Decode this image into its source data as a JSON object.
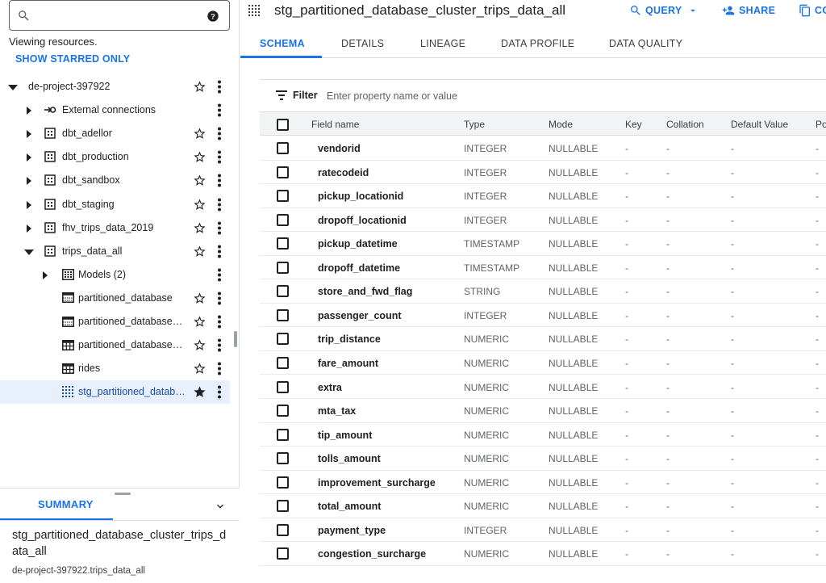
{
  "search": {
    "value": "",
    "placeholder": ""
  },
  "viewing_text": "Viewing resources.",
  "show_starred": "SHOW STARRED ONLY",
  "tree": [
    {
      "label": "de-project-397922",
      "level": 0,
      "expanded": true,
      "icon": "none",
      "star": true,
      "starred": false,
      "top": 0
    },
    {
      "label": "External connections",
      "level": 1,
      "expanded": false,
      "icon": "connection-icon",
      "star": false,
      "starred": false
    },
    {
      "label": "dbt_adellor",
      "level": 1,
      "expanded": false,
      "icon": "dataset-icon",
      "star": true,
      "starred": false
    },
    {
      "label": "dbt_production",
      "level": 1,
      "expanded": false,
      "icon": "dataset-icon",
      "star": true,
      "starred": false
    },
    {
      "label": "dbt_sandbox",
      "level": 1,
      "expanded": false,
      "icon": "dataset-icon",
      "star": true,
      "starred": false
    },
    {
      "label": "dbt_staging",
      "level": 1,
      "expanded": false,
      "icon": "dataset-icon",
      "star": true,
      "starred": false
    },
    {
      "label": "fhv_trips_data_2019",
      "level": 1,
      "expanded": false,
      "icon": "dataset-icon",
      "star": true,
      "starred": false
    },
    {
      "label": "trips_data_all",
      "level": 1,
      "expanded": true,
      "icon": "dataset-icon",
      "star": true,
      "starred": false
    },
    {
      "label": "Models (2)",
      "level": 2,
      "expanded": false,
      "icon": "models-icon",
      "star": false,
      "starred": false
    },
    {
      "label": "partitioned_database",
      "level": 2,
      "expanded": null,
      "icon": "partitioned-table-icon",
      "star": true,
      "starred": false
    },
    {
      "label": "partitioned_database_cl...",
      "level": 2,
      "expanded": null,
      "icon": "partitioned-table-icon",
      "star": true,
      "starred": false
    },
    {
      "label": "partitioned_database_cl...",
      "level": 2,
      "expanded": null,
      "icon": "table-icon",
      "star": true,
      "starred": false
    },
    {
      "label": "rides",
      "level": 2,
      "expanded": null,
      "icon": "table-icon",
      "star": true,
      "starred": false
    },
    {
      "label": "stg_partitioned_databa...",
      "level": 2,
      "expanded": null,
      "icon": "view-icon",
      "star": true,
      "starred": true,
      "selected": true
    }
  ],
  "summary": {
    "tab_label": "SUMMARY",
    "title": "stg_partitioned_database_cluster_trips_data_all",
    "path": "de-project-397922.trips_data_all"
  },
  "header": {
    "title": "stg_partitioned_database_cluster_trips_data_all",
    "query_label": "QUERY",
    "share_label": "SHARE",
    "copy_label": "CO"
  },
  "tabs": [
    "SCHEMA",
    "DETAILS",
    "LINEAGE",
    "DATA PROFILE",
    "DATA QUALITY"
  ],
  "active_tab": "SCHEMA",
  "filter": {
    "label": "Filter",
    "placeholder": "Enter property name or value"
  },
  "columns": [
    "Field name",
    "Type",
    "Mode",
    "Key",
    "Collation",
    "Default Value",
    "Po"
  ],
  "rows": [
    {
      "name": "vendorid",
      "type": "INTEGER",
      "mode": "NULLABLE",
      "key": "-",
      "collation": "-",
      "default": "-",
      "policy": "-"
    },
    {
      "name": "ratecodeid",
      "type": "INTEGER",
      "mode": "NULLABLE",
      "key": "-",
      "collation": "-",
      "default": "-",
      "policy": "-"
    },
    {
      "name": "pickup_locationid",
      "type": "INTEGER",
      "mode": "NULLABLE",
      "key": "-",
      "collation": "-",
      "default": "-",
      "policy": "-"
    },
    {
      "name": "dropoff_locationid",
      "type": "INTEGER",
      "mode": "NULLABLE",
      "key": "-",
      "collation": "-",
      "default": "-",
      "policy": "-"
    },
    {
      "name": "pickup_datetime",
      "type": "TIMESTAMP",
      "mode": "NULLABLE",
      "key": "-",
      "collation": "-",
      "default": "-",
      "policy": "-"
    },
    {
      "name": "dropoff_datetime",
      "type": "TIMESTAMP",
      "mode": "NULLABLE",
      "key": "-",
      "collation": "-",
      "default": "-",
      "policy": "-"
    },
    {
      "name": "store_and_fwd_flag",
      "type": "STRING",
      "mode": "NULLABLE",
      "key": "-",
      "collation": "-",
      "default": "-",
      "policy": "-"
    },
    {
      "name": "passenger_count",
      "type": "INTEGER",
      "mode": "NULLABLE",
      "key": "-",
      "collation": "-",
      "default": "-",
      "policy": "-"
    },
    {
      "name": "trip_distance",
      "type": "NUMERIC",
      "mode": "NULLABLE",
      "key": "-",
      "collation": "-",
      "default": "-",
      "policy": "-"
    },
    {
      "name": "fare_amount",
      "type": "NUMERIC",
      "mode": "NULLABLE",
      "key": "-",
      "collation": "-",
      "default": "-",
      "policy": "-"
    },
    {
      "name": "extra",
      "type": "NUMERIC",
      "mode": "NULLABLE",
      "key": "-",
      "collation": "-",
      "default": "-",
      "policy": "-"
    },
    {
      "name": "mta_tax",
      "type": "NUMERIC",
      "mode": "NULLABLE",
      "key": "-",
      "collation": "-",
      "default": "-",
      "policy": "-"
    },
    {
      "name": "tip_amount",
      "type": "NUMERIC",
      "mode": "NULLABLE",
      "key": "-",
      "collation": "-",
      "default": "-",
      "policy": "-"
    },
    {
      "name": "tolls_amount",
      "type": "NUMERIC",
      "mode": "NULLABLE",
      "key": "-",
      "collation": "-",
      "default": "-",
      "policy": "-"
    },
    {
      "name": "improvement_surcharge",
      "type": "NUMERIC",
      "mode": "NULLABLE",
      "key": "-",
      "collation": "-",
      "default": "-",
      "policy": "-"
    },
    {
      "name": "total_amount",
      "type": "NUMERIC",
      "mode": "NULLABLE",
      "key": "-",
      "collation": "-",
      "default": "-",
      "policy": "-"
    },
    {
      "name": "payment_type",
      "type": "INTEGER",
      "mode": "NULLABLE",
      "key": "-",
      "collation": "-",
      "default": "-",
      "policy": "-"
    },
    {
      "name": "congestion_surcharge",
      "type": "NUMERIC",
      "mode": "NULLABLE",
      "key": "-",
      "collation": "-",
      "default": "-",
      "policy": "-"
    }
  ],
  "colors": {
    "accent": "#1a73e8",
    "selected_bg": "#e8f0fe",
    "header_bg": "#f1f3f4",
    "border": "#dadce0"
  }
}
